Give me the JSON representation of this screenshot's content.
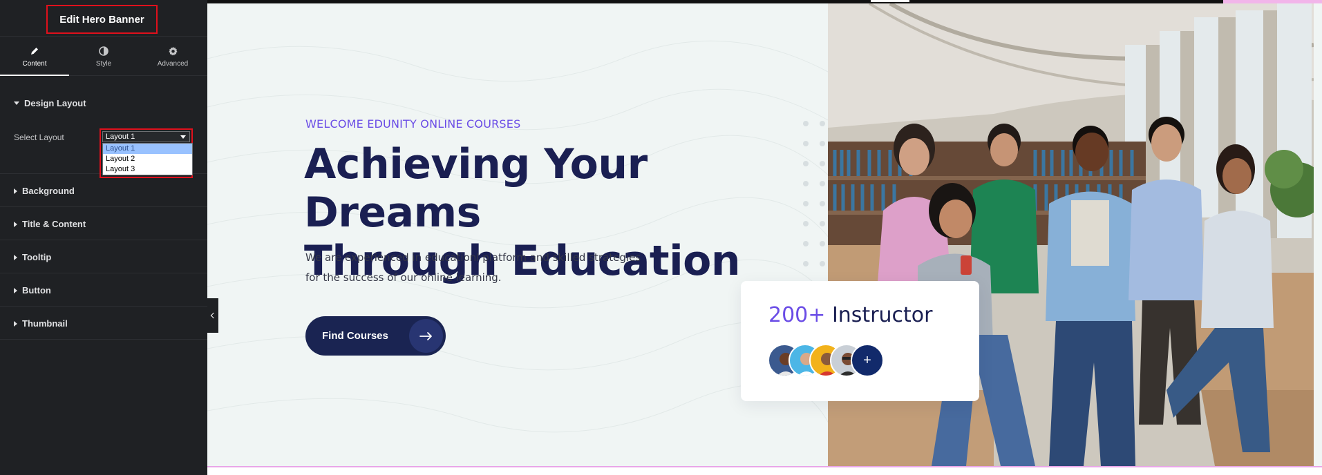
{
  "panel": {
    "title": "Edit Hero Banner",
    "tabs": [
      {
        "label": "Content",
        "icon": "pencil-icon",
        "active": true
      },
      {
        "label": "Style",
        "icon": "half-circle-icon",
        "active": false
      },
      {
        "label": "Advanced",
        "icon": "gear-icon",
        "active": false
      }
    ],
    "design_section": {
      "title": "Design Layout",
      "select_label": "Select Layout",
      "select_value": "Layout 1",
      "options": [
        "Layout 1",
        "Layout 2",
        "Layout 3"
      ]
    },
    "sections": [
      "Background",
      "Title & Content",
      "Tooltip",
      "Button",
      "Thumbnail"
    ]
  },
  "hero": {
    "pretitle": "WELCOME EDUNITY ONLINE COURSES",
    "title_line1": "Achieving Your Dreams",
    "title_line2": "Through Education",
    "desc_line1": "We are experienced in educationl platform and skilled strategies",
    "desc_line2": "for the success of our online learning.",
    "button_label": "Find Courses",
    "button_icon": "arrow-right-icon",
    "card": {
      "count": "200+",
      "label": " Instructor",
      "plus": "+"
    }
  },
  "colors": {
    "accent": "#6a4ce6",
    "navy": "#1a1f52",
    "panel_bg": "#1f2124",
    "highlight_border": "#e0101c"
  }
}
